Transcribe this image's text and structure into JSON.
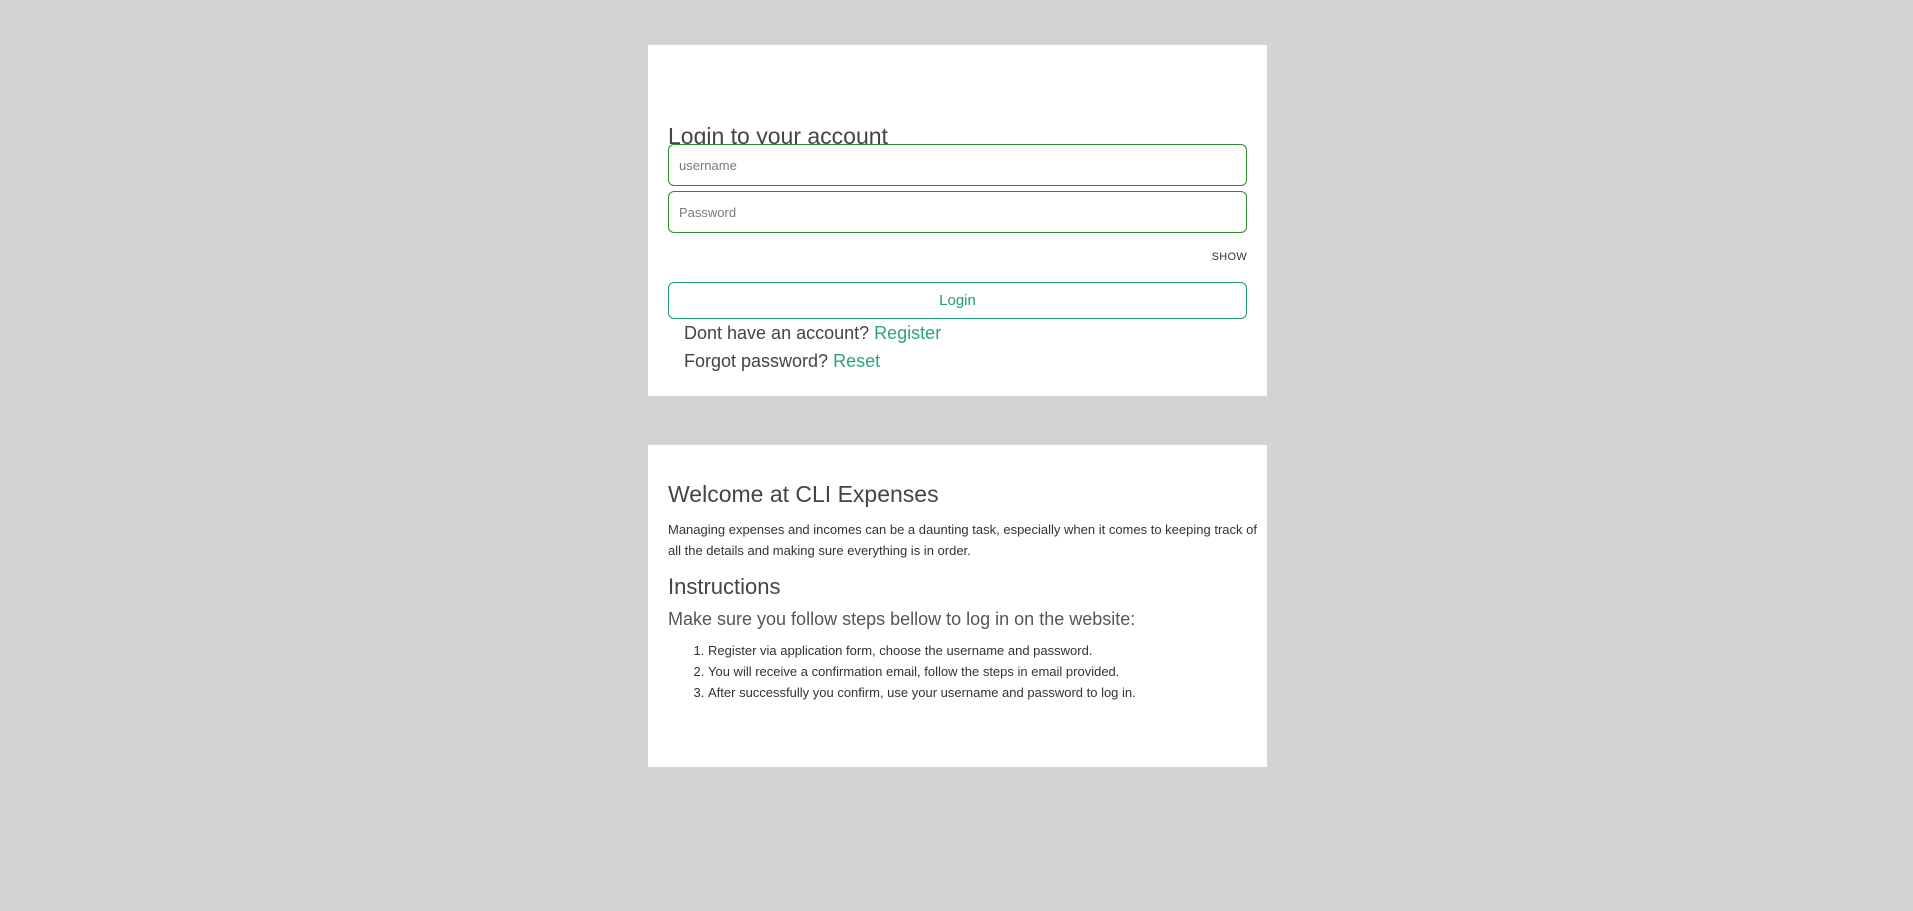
{
  "login": {
    "title": "Login to your account",
    "username_placeholder": "username",
    "password_placeholder": "Password",
    "show_label": "SHOW",
    "login_button": "Login",
    "register_prompt": "Dont have an account?",
    "register_link": "Register",
    "forgot_prompt": "Forgot password?",
    "reset_link": "Reset"
  },
  "welcome": {
    "title": "Welcome at CLI Expenses",
    "body": "Managing expenses and incomes can be a daunting task, especially when it comes to keeping track of all the details and making sure everything is in order.",
    "instructions_title": "Instructions",
    "instructions_subtitle": "Make sure you follow steps bellow to log in on the website:",
    "steps": [
      "Register via application form, choose the username and password.",
      "You will receive a confirmation email, follow the steps in email provided.",
      "After successfully you confirm, use your username and password to log in."
    ]
  },
  "colors": {
    "page_background": "#d3d3d3",
    "card_background": "#ffffff",
    "input_border": "#2e8b2e",
    "accent": "#2aa383"
  }
}
